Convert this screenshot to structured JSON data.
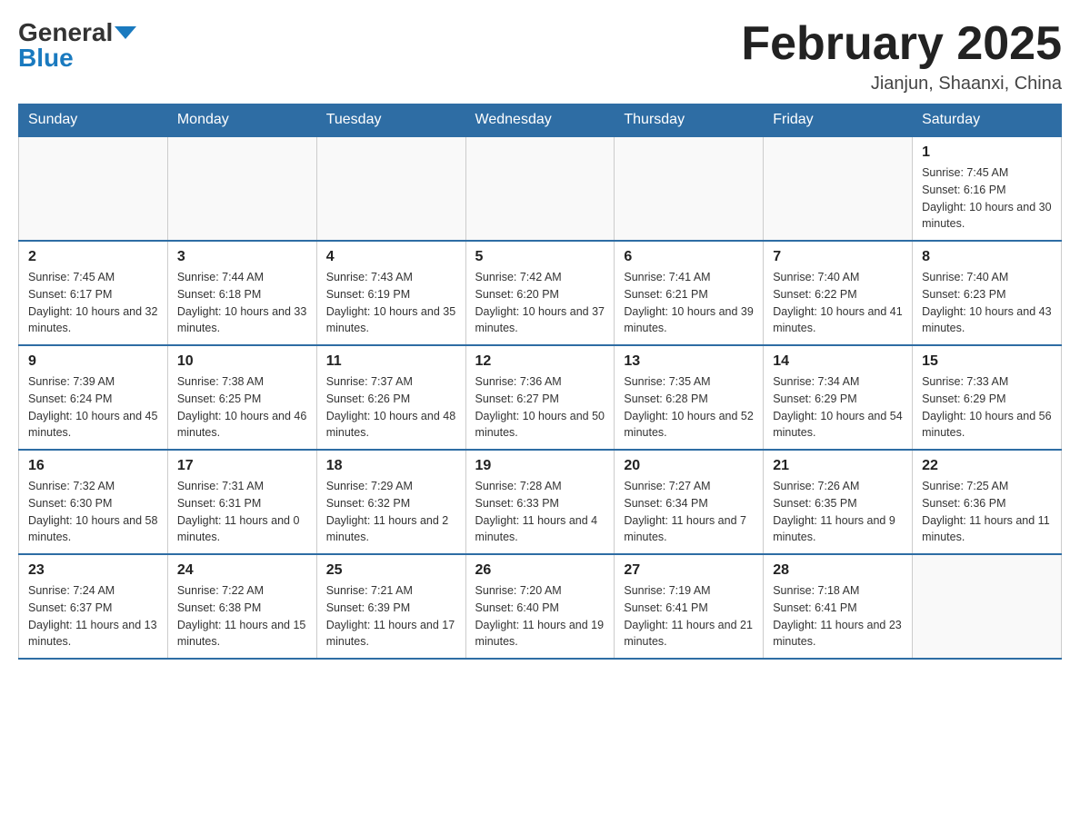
{
  "header": {
    "logo_text1": "General",
    "logo_text2": "Blue",
    "month_title": "February 2025",
    "location": "Jianjun, Shaanxi, China"
  },
  "days_of_week": [
    "Sunday",
    "Monday",
    "Tuesday",
    "Wednesday",
    "Thursday",
    "Friday",
    "Saturday"
  ],
  "weeks": [
    [
      {
        "day": "",
        "info": ""
      },
      {
        "day": "",
        "info": ""
      },
      {
        "day": "",
        "info": ""
      },
      {
        "day": "",
        "info": ""
      },
      {
        "day": "",
        "info": ""
      },
      {
        "day": "",
        "info": ""
      },
      {
        "day": "1",
        "info": "Sunrise: 7:45 AM\nSunset: 6:16 PM\nDaylight: 10 hours and 30 minutes."
      }
    ],
    [
      {
        "day": "2",
        "info": "Sunrise: 7:45 AM\nSunset: 6:17 PM\nDaylight: 10 hours and 32 minutes."
      },
      {
        "day": "3",
        "info": "Sunrise: 7:44 AM\nSunset: 6:18 PM\nDaylight: 10 hours and 33 minutes."
      },
      {
        "day": "4",
        "info": "Sunrise: 7:43 AM\nSunset: 6:19 PM\nDaylight: 10 hours and 35 minutes."
      },
      {
        "day": "5",
        "info": "Sunrise: 7:42 AM\nSunset: 6:20 PM\nDaylight: 10 hours and 37 minutes."
      },
      {
        "day": "6",
        "info": "Sunrise: 7:41 AM\nSunset: 6:21 PM\nDaylight: 10 hours and 39 minutes."
      },
      {
        "day": "7",
        "info": "Sunrise: 7:40 AM\nSunset: 6:22 PM\nDaylight: 10 hours and 41 minutes."
      },
      {
        "day": "8",
        "info": "Sunrise: 7:40 AM\nSunset: 6:23 PM\nDaylight: 10 hours and 43 minutes."
      }
    ],
    [
      {
        "day": "9",
        "info": "Sunrise: 7:39 AM\nSunset: 6:24 PM\nDaylight: 10 hours and 45 minutes."
      },
      {
        "day": "10",
        "info": "Sunrise: 7:38 AM\nSunset: 6:25 PM\nDaylight: 10 hours and 46 minutes."
      },
      {
        "day": "11",
        "info": "Sunrise: 7:37 AM\nSunset: 6:26 PM\nDaylight: 10 hours and 48 minutes."
      },
      {
        "day": "12",
        "info": "Sunrise: 7:36 AM\nSunset: 6:27 PM\nDaylight: 10 hours and 50 minutes."
      },
      {
        "day": "13",
        "info": "Sunrise: 7:35 AM\nSunset: 6:28 PM\nDaylight: 10 hours and 52 minutes."
      },
      {
        "day": "14",
        "info": "Sunrise: 7:34 AM\nSunset: 6:29 PM\nDaylight: 10 hours and 54 minutes."
      },
      {
        "day": "15",
        "info": "Sunrise: 7:33 AM\nSunset: 6:29 PM\nDaylight: 10 hours and 56 minutes."
      }
    ],
    [
      {
        "day": "16",
        "info": "Sunrise: 7:32 AM\nSunset: 6:30 PM\nDaylight: 10 hours and 58 minutes."
      },
      {
        "day": "17",
        "info": "Sunrise: 7:31 AM\nSunset: 6:31 PM\nDaylight: 11 hours and 0 minutes."
      },
      {
        "day": "18",
        "info": "Sunrise: 7:29 AM\nSunset: 6:32 PM\nDaylight: 11 hours and 2 minutes."
      },
      {
        "day": "19",
        "info": "Sunrise: 7:28 AM\nSunset: 6:33 PM\nDaylight: 11 hours and 4 minutes."
      },
      {
        "day": "20",
        "info": "Sunrise: 7:27 AM\nSunset: 6:34 PM\nDaylight: 11 hours and 7 minutes."
      },
      {
        "day": "21",
        "info": "Sunrise: 7:26 AM\nSunset: 6:35 PM\nDaylight: 11 hours and 9 minutes."
      },
      {
        "day": "22",
        "info": "Sunrise: 7:25 AM\nSunset: 6:36 PM\nDaylight: 11 hours and 11 minutes."
      }
    ],
    [
      {
        "day": "23",
        "info": "Sunrise: 7:24 AM\nSunset: 6:37 PM\nDaylight: 11 hours and 13 minutes."
      },
      {
        "day": "24",
        "info": "Sunrise: 7:22 AM\nSunset: 6:38 PM\nDaylight: 11 hours and 15 minutes."
      },
      {
        "day": "25",
        "info": "Sunrise: 7:21 AM\nSunset: 6:39 PM\nDaylight: 11 hours and 17 minutes."
      },
      {
        "day": "26",
        "info": "Sunrise: 7:20 AM\nSunset: 6:40 PM\nDaylight: 11 hours and 19 minutes."
      },
      {
        "day": "27",
        "info": "Sunrise: 7:19 AM\nSunset: 6:41 PM\nDaylight: 11 hours and 21 minutes."
      },
      {
        "day": "28",
        "info": "Sunrise: 7:18 AM\nSunset: 6:41 PM\nDaylight: 11 hours and 23 minutes."
      },
      {
        "day": "",
        "info": ""
      }
    ]
  ]
}
